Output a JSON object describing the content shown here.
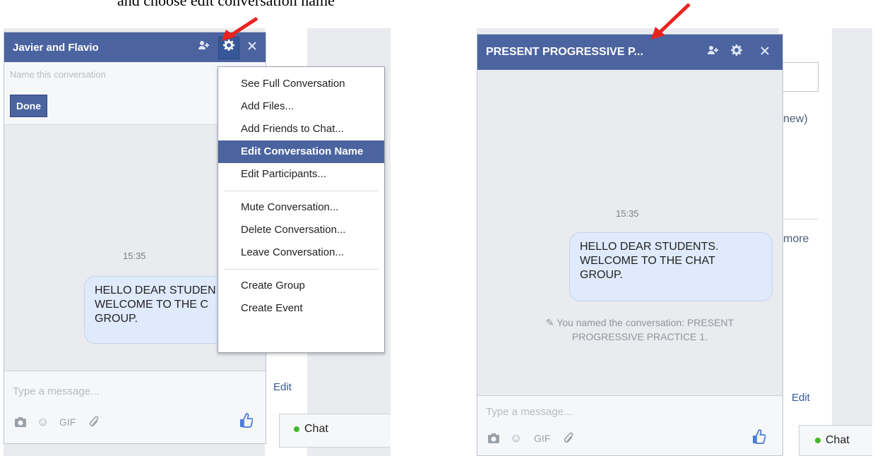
{
  "caption": "and choose edit conversation name",
  "left": {
    "chat_title": "Javier and Flavio",
    "name_placeholder": "Name this conversation",
    "done_label": "Done",
    "timestamp": "15:35",
    "bubble_lines": [
      "HELLO DEAR STUDEN",
      "WELCOME TO THE C",
      "GROUP."
    ],
    "composer_placeholder": "Type a message...",
    "gif_label": "GIF",
    "side_edit": "Edit",
    "chat_button": "Chat",
    "menu": {
      "group1": [
        "See Full Conversation",
        "Add Files...",
        "Add Friends to Chat...",
        "Edit Conversation Name",
        "Edit Participants..."
      ],
      "group2": [
        "Mute Conversation...",
        "Delete Conversation...",
        "Leave Conversation..."
      ],
      "group3": [
        "Create Group",
        "Create Event"
      ],
      "active_item": "Edit Conversation Name"
    }
  },
  "right": {
    "chat_title": "PRESENT PROGRESSIVE P...",
    "timestamp": "15:35",
    "bubble_lines": [
      "HELLO DEAR STUDENTS.",
      "WELCOME TO THE CHAT",
      "GROUP."
    ],
    "system_message_lines": [
      "You named the conversation: PRESENT",
      "PROGRESSIVE PRACTICE 1."
    ],
    "composer_placeholder": "Type a message...",
    "gif_label": "GIF",
    "side_new": "new)",
    "side_more": "more",
    "side_edit": "Edit",
    "chat_button": "Chat"
  },
  "icons": [
    "add-friend-icon",
    "gear-icon",
    "close-icon",
    "camera-icon",
    "emoji-icon",
    "attach-icon",
    "thumbs-up-icon",
    "pencil-icon",
    "red-arrow"
  ],
  "colors": {
    "titlebar": "#4b64a0",
    "bubble": "#dfeafc",
    "online_dot": "#42b72a",
    "arrow": "#e8231e"
  }
}
